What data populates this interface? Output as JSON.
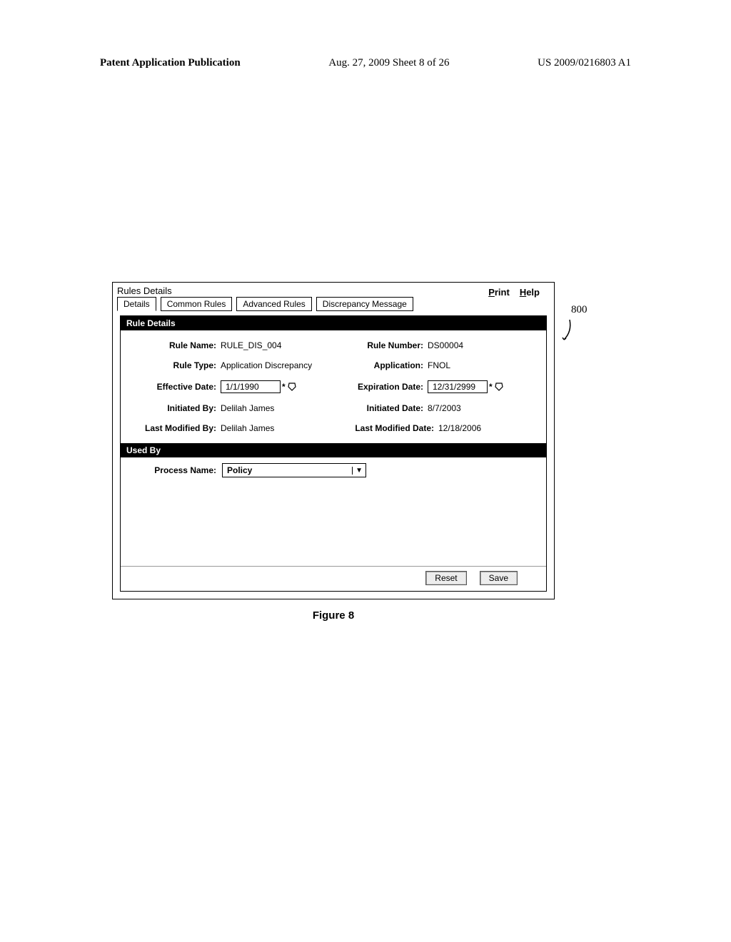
{
  "doc_header": {
    "left": "Patent Application Publication",
    "center": "Aug. 27, 2009  Sheet 8 of 26",
    "right": "US 2009/0216803 A1"
  },
  "window": {
    "title": "Rules Details",
    "toplinks": {
      "print": "Print",
      "help": "Help"
    }
  },
  "tabs": [
    "Details",
    "Common Rules",
    "Advanced Rules",
    "Discrepancy Message"
  ],
  "rule_details": {
    "header": "Rule Details",
    "labels": {
      "rule_name": "Rule Name:",
      "rule_number": "Rule Number:",
      "rule_type": "Rule Type:",
      "application": "Application:",
      "effective_date": "Effective Date:",
      "expiration_date": "Expiration Date:",
      "initiated_by": "Initiated By:",
      "initiated_date": "Initiated Date:",
      "last_modified_by": "Last Modified By:",
      "last_modified_date": "Last Modified Date:"
    },
    "values": {
      "rule_name": "RULE_DIS_004",
      "rule_number": "DS00004",
      "rule_type": "Application Discrepancy",
      "application": "FNOL",
      "effective_date": "1/1/1990",
      "expiration_date": "12/31/2999",
      "initiated_by": "Delilah James",
      "initiated_date": "8/7/2003",
      "last_modified_by": "Delilah James",
      "last_modified_date": "12/18/2006"
    }
  },
  "used_by": {
    "header": "Used By",
    "label": "Process Name:",
    "value": "Policy"
  },
  "buttons": {
    "reset": "Reset",
    "save": "Save"
  },
  "figure_caption": "Figure 8",
  "ref": {
    "label_800": "800"
  }
}
